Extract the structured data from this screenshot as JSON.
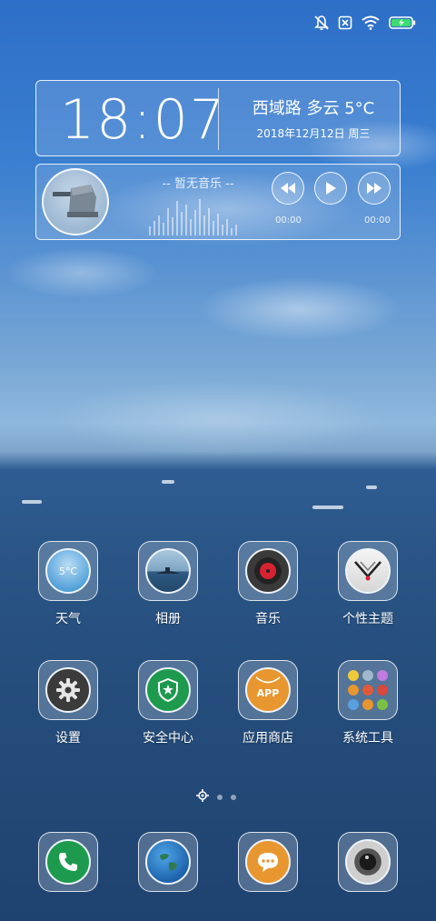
{
  "clock": {
    "time": "18:07",
    "weather": "西域路 多云 5°C",
    "date": "2018年12月12日 周三"
  },
  "music": {
    "title": "-- 暂无音乐 --",
    "elapsed": "00:00",
    "duration": "00:00"
  },
  "apps_row1": [
    {
      "label": "天气",
      "badge": "5°C",
      "icon": "weather-icon"
    },
    {
      "label": "相册",
      "icon": "gallery-icon"
    },
    {
      "label": "音乐",
      "icon": "music-disc-icon"
    },
    {
      "label": "个性主题",
      "icon": "themes-icon"
    }
  ],
  "apps_row2": [
    {
      "label": "设置",
      "icon": "gear-icon"
    },
    {
      "label": "安全中心",
      "icon": "shield-icon"
    },
    {
      "label": "应用商店",
      "badge": "APP",
      "icon": "app-store-icon"
    },
    {
      "label": "系统工具",
      "icon": "folder-icon"
    }
  ],
  "dock": [
    {
      "icon": "phone-icon"
    },
    {
      "icon": "browser-globe-icon"
    },
    {
      "icon": "message-icon"
    },
    {
      "icon": "camera-icon"
    }
  ],
  "colors": {
    "green": "#1e9a4e",
    "orange": "#e8962f",
    "music_red": "#d72331"
  }
}
